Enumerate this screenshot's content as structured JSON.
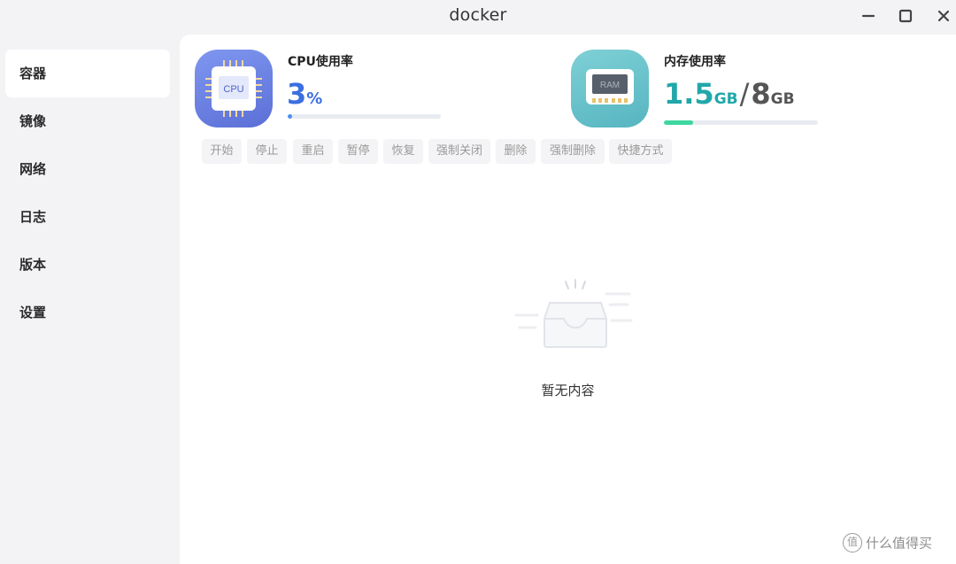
{
  "window": {
    "title": "docker"
  },
  "sidebar": {
    "items": [
      {
        "label": "容器",
        "active": true
      },
      {
        "label": "镜像"
      },
      {
        "label": "网络"
      },
      {
        "label": "日志"
      },
      {
        "label": "版本"
      },
      {
        "label": "设置"
      }
    ]
  },
  "stats": {
    "cpu": {
      "label": "CPU使用率",
      "value": "3",
      "unit": "%",
      "chip_text": "CPU",
      "progress": 0.03
    },
    "memory": {
      "label": "内存使用率",
      "used": "1.5",
      "used_unit": "GB",
      "separator": "/",
      "total": "8",
      "total_unit": "GB",
      "chip_text": "RAM",
      "progress": 0.1875
    }
  },
  "toolbar": {
    "buttons": [
      "开始",
      "停止",
      "重启",
      "暂停",
      "恢复",
      "强制关闭",
      "删除",
      "强制删除",
      "快捷方式"
    ]
  },
  "empty_state": {
    "text": "暂无内容",
    "icon": "empty-inbox-icon"
  },
  "watermark": {
    "text": "什么值得买",
    "logo_char": "值"
  },
  "colors": {
    "cpu_accent": "#3b6fe0",
    "ram_accent": "#21a7a9",
    "ram_bar": "#3dd7a0",
    "cpu_bar": "#4a90f0"
  }
}
